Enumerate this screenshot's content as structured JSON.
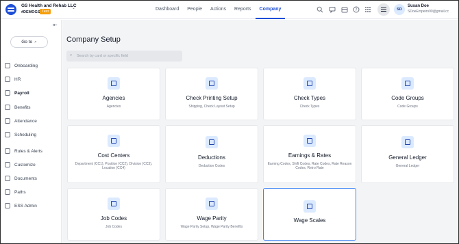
{
  "header": {
    "company_name": "GS Health and Rehab LLC",
    "company_code": "#DEMOGS",
    "env_badge": "Test",
    "nav": [
      "Dashboard",
      "People",
      "Actions",
      "Reports",
      "Company"
    ],
    "active_nav": "Company",
    "user": {
      "initials": "SD",
      "name": "Susan Doe",
      "email": "SDoeEmpeiro90@gmail.cc"
    },
    "icons": [
      "search-icon",
      "chat-icon",
      "calendar-icon",
      "help-icon",
      "grid-icon",
      "settings-icon"
    ]
  },
  "sidebar": {
    "goto_label": "Go to",
    "items": [
      {
        "label": "Onboarding",
        "icon": "onboarding-icon"
      },
      {
        "label": "HR",
        "icon": "hr-icon"
      },
      {
        "label": "Payroll",
        "icon": "payroll-icon",
        "active": true
      },
      {
        "label": "Benefits",
        "icon": "benefits-icon"
      },
      {
        "label": "Attendance",
        "icon": "attendance-icon"
      },
      {
        "label": "Scheduling",
        "icon": "scheduling-icon"
      },
      {
        "label": "Rules & Alerts",
        "icon": "rules-icon"
      },
      {
        "label": "Customize",
        "icon": "customize-icon"
      },
      {
        "label": "Documents",
        "icon": "documents-icon"
      },
      {
        "label": "Paths",
        "icon": "paths-icon"
      },
      {
        "label": "ESS Admin",
        "icon": "ess-admin-icon"
      }
    ]
  },
  "main": {
    "title": "Company Setup",
    "search_placeholder": "Search by card or specific field",
    "cards": [
      {
        "title": "Agencies",
        "sub": "Agencies"
      },
      {
        "title": "Check Printing Setup",
        "sub": "Shipping, Check Layout Setup"
      },
      {
        "title": "Check Types",
        "sub": "Check Types"
      },
      {
        "title": "Code Groups",
        "sub": "Code Groups"
      },
      {
        "title": "Cost Centers",
        "sub": "Department (CC1), Position (CC2), Division (CC3), Location (CC4)"
      },
      {
        "title": "Deductions",
        "sub": "Deduction Codes"
      },
      {
        "title": "Earnings & Rates",
        "sub": "Earning Codes, Shift Codes, Rate Codes, Rate Reason Codes, Retro Rate"
      },
      {
        "title": "General Ledger",
        "sub": "General Ledger"
      },
      {
        "title": "Job Codes",
        "sub": "Job Codes"
      },
      {
        "title": "Wage Parity",
        "sub": "Wage Parity Setup, Wage Parity Benefits"
      },
      {
        "title": "Wage Scales",
        "sub": "",
        "selected": true
      }
    ]
  }
}
